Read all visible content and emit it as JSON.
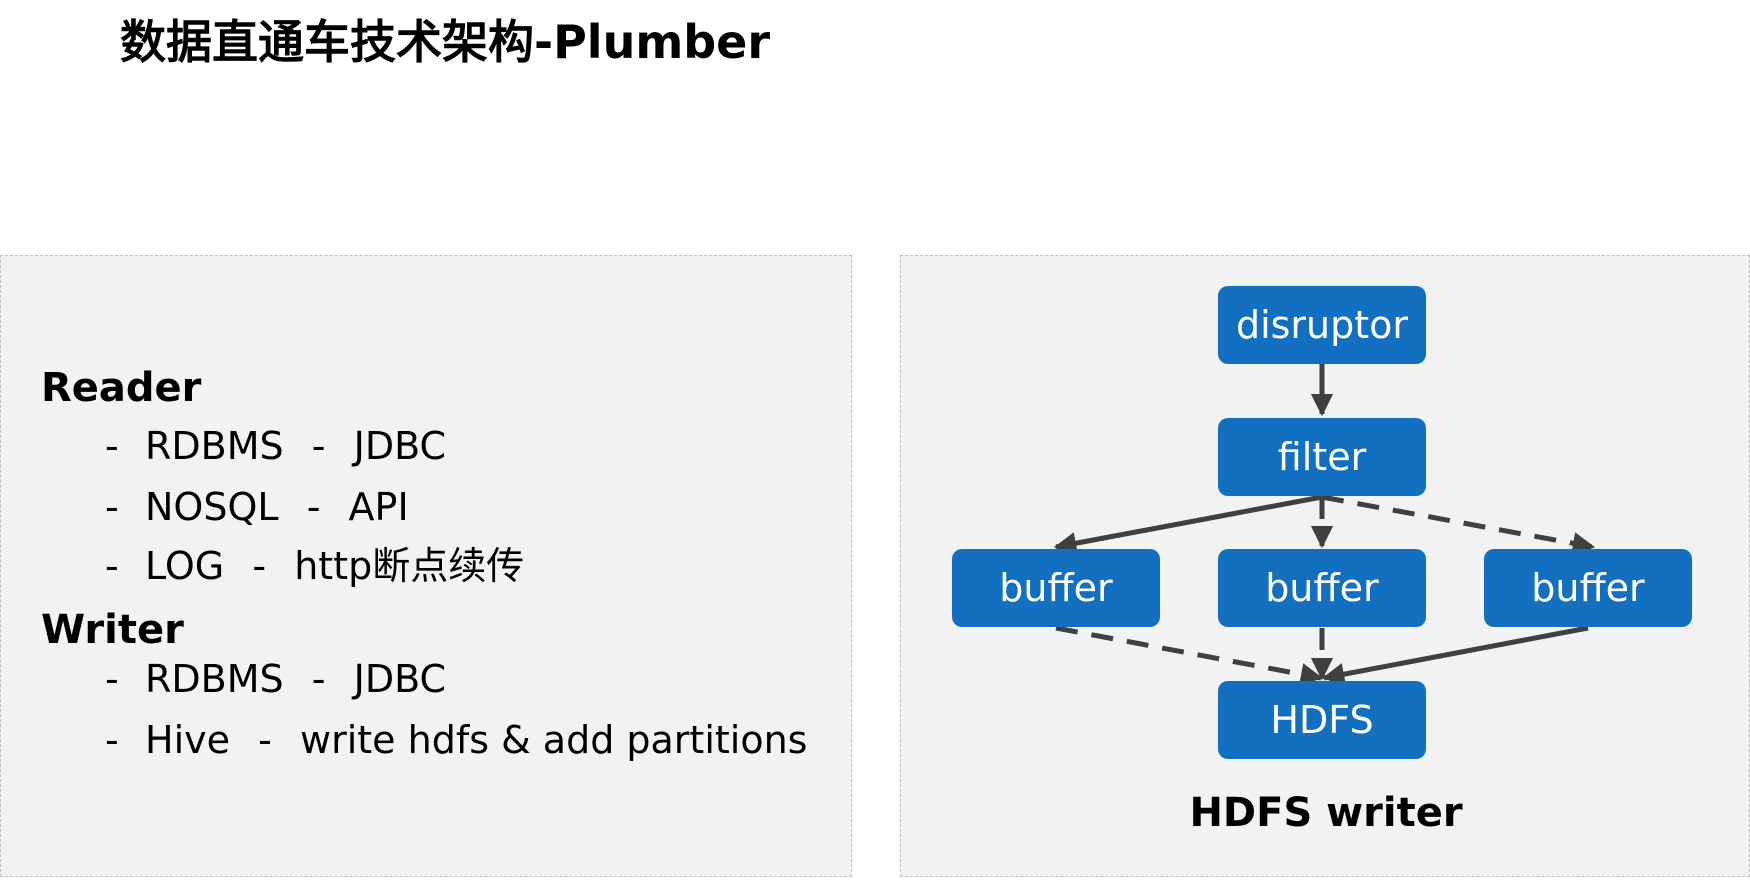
{
  "title": "数据直通车技术架构-Plumber",
  "left_panel": {
    "reader": {
      "heading": "Reader",
      "items": [
        {
          "dash": "-",
          "name": "RDBMS",
          "sep": "-",
          "detail": "JDBC"
        },
        {
          "dash": "-",
          "name": "NOSQL",
          "sep": "-",
          "detail": "API"
        },
        {
          "dash": "-",
          "name": "LOG",
          "sep": "-",
          "detail": "http断点续传"
        }
      ]
    },
    "writer": {
      "heading": "Writer",
      "items": [
        {
          "dash": "-",
          "name": "RDBMS",
          "sep": "-",
          "detail": "JDBC"
        },
        {
          "dash": "-",
          "name": "Hive",
          "sep": "-",
          "detail": "write hdfs & add partitions"
        }
      ]
    }
  },
  "right_panel": {
    "nodes": {
      "disruptor": "disruptor",
      "filter": "filter",
      "buffer_left": "buffer",
      "buffer_center": "buffer",
      "buffer_right": "buffer",
      "hdfs": "HDFS"
    },
    "edges": [
      {
        "from": "disruptor",
        "to": "filter",
        "style": "solid"
      },
      {
        "from": "filter",
        "to": "buffer_left",
        "style": "solid"
      },
      {
        "from": "filter",
        "to": "buffer_center",
        "style": "dashed"
      },
      {
        "from": "filter",
        "to": "buffer_right",
        "style": "dashed"
      },
      {
        "from": "buffer_left",
        "to": "hdfs",
        "style": "dashed"
      },
      {
        "from": "buffer_center",
        "to": "hdfs",
        "style": "dashed"
      },
      {
        "from": "buffer_right",
        "to": "hdfs",
        "style": "solid"
      }
    ],
    "caption": "HDFS writer"
  },
  "colors": {
    "node_fill": "#1370c0",
    "node_text": "#ffffff",
    "edge": "#404040",
    "panel_bg": "#f2f2f2",
    "panel_border": "#bfbfbf"
  }
}
